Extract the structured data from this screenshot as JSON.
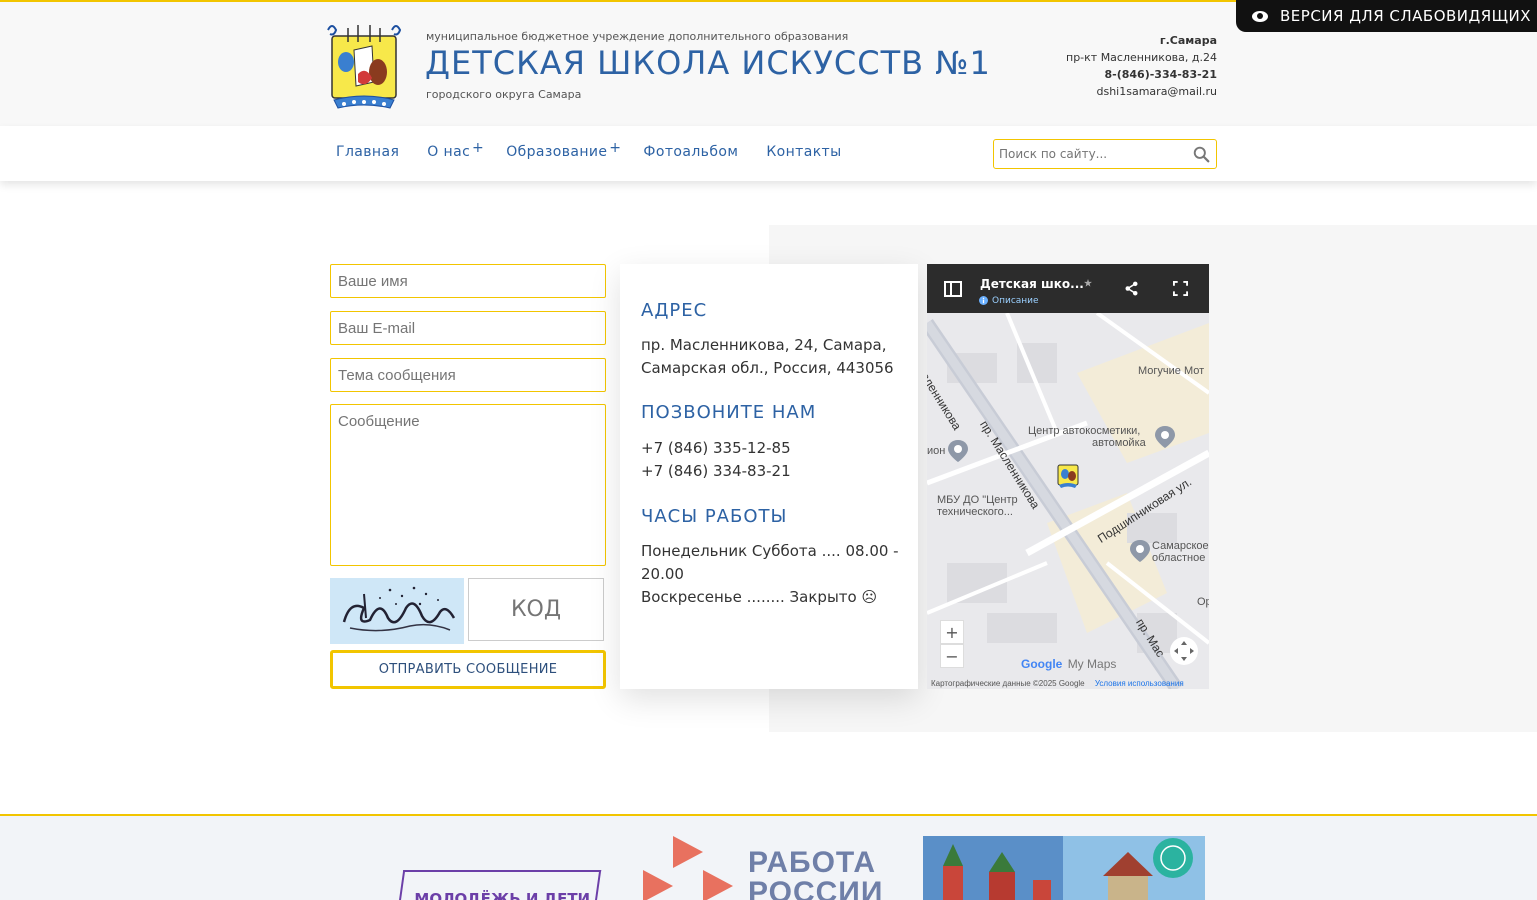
{
  "header": {
    "org_top": "муниципальное бюджетное учреждение дополнительного образования",
    "school_name": "ДЕТСКАЯ ШКОЛА ИСКУССТВ №1",
    "org_bottom": "городского округа Самара",
    "city": "г.Самара",
    "address": "пр-кт Масленникова, д.24",
    "phone": "8-(846)-334-83-21",
    "email": "dshi1samara@mail.ru",
    "vision_button": "ВЕРСИЯ ДЛЯ СЛАБОВИДЯЩИХ"
  },
  "nav": {
    "items": [
      "Главная",
      "О нас",
      "Образование",
      "Фотоальбом",
      "Контакты"
    ],
    "plus": "+",
    "search_placeholder": "Поиск по сайту..."
  },
  "form": {
    "name_placeholder": "Ваше имя",
    "email_placeholder": "Ваш E-mail",
    "subject_placeholder": "Тема сообщения",
    "message_placeholder": "Сообщение",
    "code_placeholder": "КОД",
    "send_label": "ОТПРАВИТЬ СООБЩЕНИЕ"
  },
  "info": {
    "address_title": "АДРЕС",
    "address_text": "пр. Масленникова, 24, Самара, Самарская обл., Россия, 443056",
    "call_title": "ПОЗВОНИТЕ НАМ",
    "phone1": "+7 (846) 335-12-85",
    "phone2": "+7 (846) 334-83-21",
    "hours_title": "ЧАСЫ РАБОТЫ",
    "hours_weekday": "Понедельник Суббота .... 08.00 - 20.00",
    "hours_sunday": "Воскресенье ........ Закрыто ☹"
  },
  "map": {
    "title": "Детская шко...",
    "description": "Описание",
    "labels": {
      "moguchie": "Могучие Мот",
      "avto": "Центр автокосметики,",
      "avto2": "автомойка",
      "ion": "ион",
      "mbu": "МБУ ДО \"Центр",
      "mbu2": "технического...",
      "samara1": "Самарское",
      "samara2": "областное",
      "or": "Ор"
    },
    "streets": {
      "masl1": "Масленникова",
      "masl2": "пр. Масленникова",
      "podsh": "Подшипниковая ул.",
      "masl3": "пр. Мас"
    },
    "zoom_in": "+",
    "zoom_out": "−",
    "google": "Google",
    "mymaps": "My Maps",
    "attribution": "Картографические данные ©2025 Google",
    "terms": "Условия использования"
  },
  "footer": {
    "youth_banner": "МОЛОДЁЖЬ И ДЕТИ",
    "rabota_line1": "РАБОТА",
    "rabota_line2": "РОССИИ"
  },
  "colors": {
    "accent_yellow": "#f2c500",
    "brand_blue": "#2d62a4"
  }
}
